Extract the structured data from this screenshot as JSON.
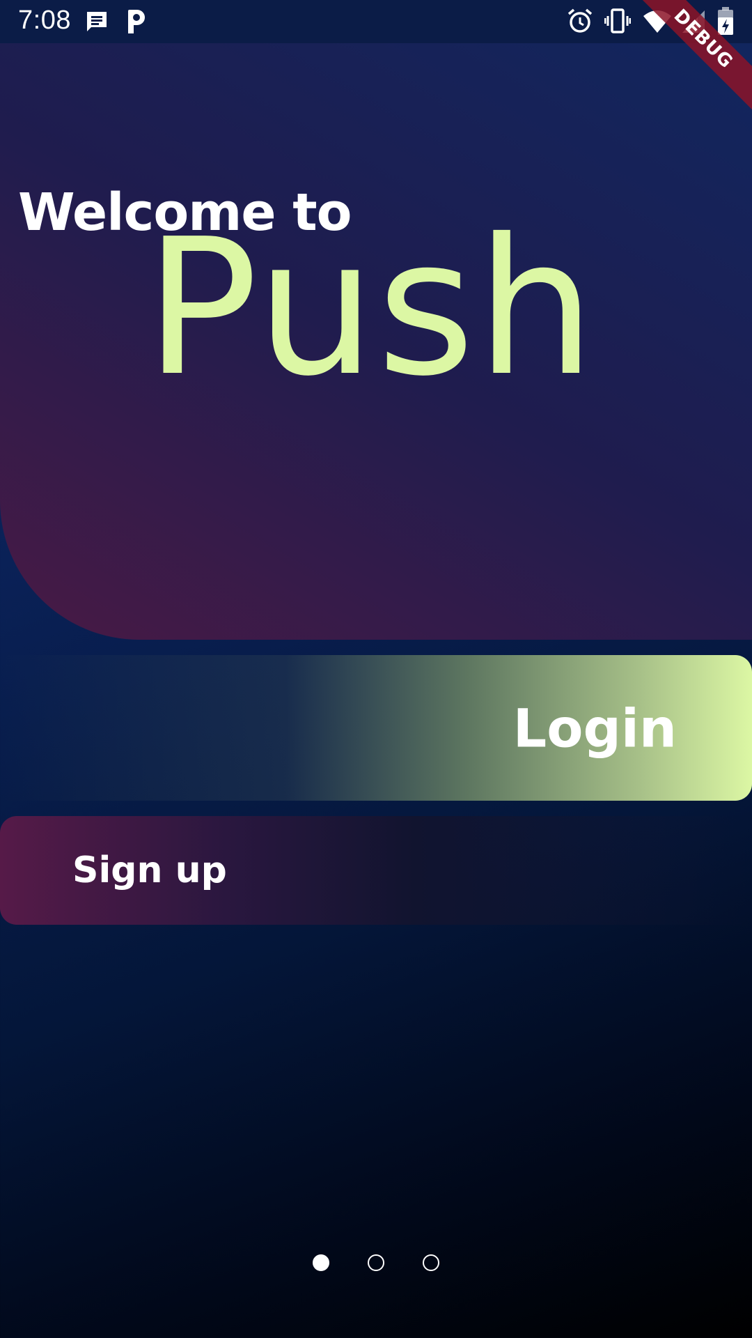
{
  "status_bar": {
    "time": "7:08",
    "icons": [
      "message-icon",
      "p-app-icon",
      "alarm-icon",
      "vibrate-icon",
      "wifi-icon",
      "signal-icon",
      "battery-icon"
    ]
  },
  "debug_banner": {
    "label": "DEBUG"
  },
  "hero": {
    "welcome": "Welcome to",
    "app_name": "Push"
  },
  "buttons": {
    "login": "Login",
    "signup": "Sign up"
  },
  "page_indicator": {
    "pages": 3,
    "active_index": 0
  },
  "colors": {
    "accent": "#dcf7a4",
    "hero_gradient_start": "#491a45",
    "hero_gradient_end": "#11265e",
    "signup_gradient_start": "#561a48",
    "background": "#0a2157",
    "debug_banner": "#8c1428"
  }
}
